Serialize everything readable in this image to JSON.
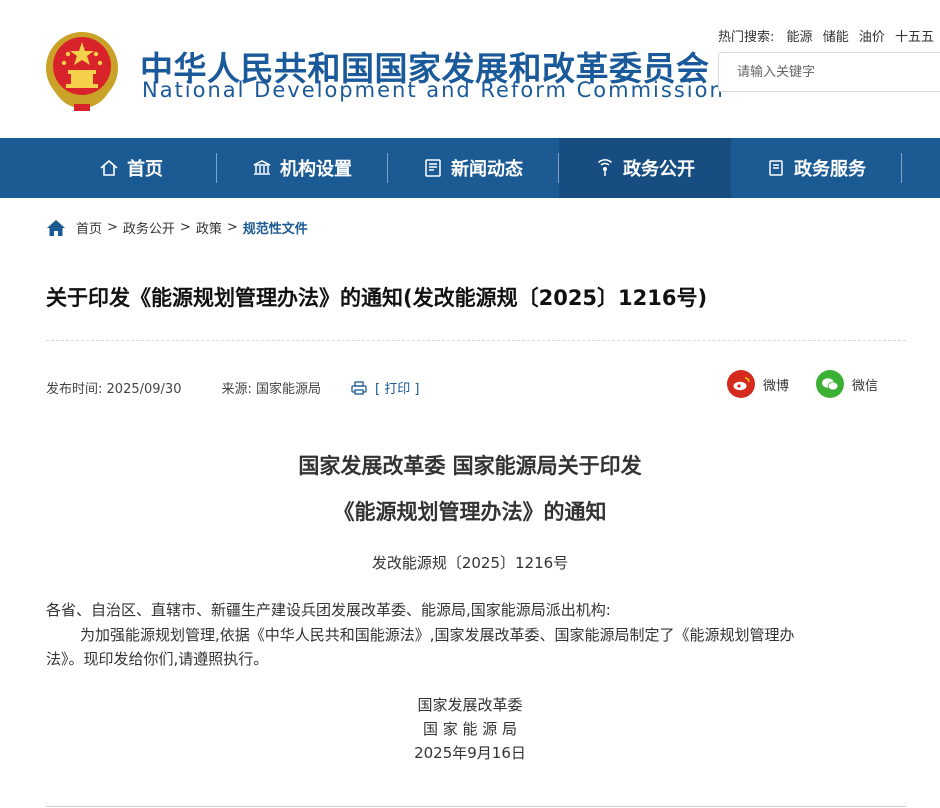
{
  "header": {
    "title_cn": "中华人民共和国国家发展和改革委员会",
    "title_en": "National Development and Reform Commission",
    "hot_label": "热门搜索:",
    "hot_links": [
      "能源",
      "储能",
      "油价",
      "十五五"
    ],
    "search_placeholder": "请输入关键字"
  },
  "nav": {
    "items": [
      {
        "label": "首页",
        "icon": "home-icon"
      },
      {
        "label": "机构设置",
        "icon": "institution-icon"
      },
      {
        "label": "新闻动态",
        "icon": "news-icon"
      },
      {
        "label": "政务公开",
        "icon": "broadcast-icon"
      },
      {
        "label": "政务服务",
        "icon": "service-icon"
      }
    ],
    "active_index": 3,
    "bar_color": "#1c5a94",
    "active_color": "#174d80"
  },
  "breadcrumb": {
    "items": [
      "首页",
      "政务公开",
      "政策"
    ],
    "separator": ">",
    "current": "规范性文件"
  },
  "article": {
    "title": "关于印发《能源规划管理办法》的通知(发改能源规〔2025〕1216号)",
    "publish_label": "发布时间:",
    "publish_date": "2025/09/30",
    "source_label": "来源:",
    "source": "国家能源局",
    "print_label": "[ 打印 ]",
    "share": {
      "weibo_label": "微博",
      "wechat_label": "微信",
      "weibo_color": "#d52b1e",
      "wechat_color": "#3cb034"
    },
    "doc_heading_line1": "国家发展改革委 国家能源局关于印发",
    "doc_heading_line2": "《能源规划管理办法》的通知",
    "doc_number": "发改能源规〔2025〕1216号",
    "addressee": "各省、自治区、直辖市、新疆生产建设兵团发展改革委、能源局,国家能源局派出机构:",
    "body_line1": "为加强能源规划管理,依据《中华人民共和国能源法》,国家发展改革委、国家能源局制定了《能源规划管理办",
    "body_line2": "法》。现印发给你们,请遵照执行。",
    "signatory1": "国家发展改革委",
    "signatory2": "国 家 能 源 局",
    "sign_date": "2025年9月16日"
  }
}
